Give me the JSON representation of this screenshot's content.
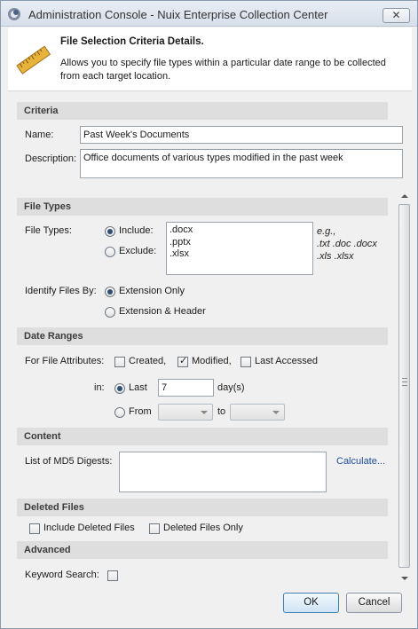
{
  "window": {
    "title": "Administration Console - Nuix Enterprise Collection Center",
    "close_label": "✕"
  },
  "header": {
    "title": "File Selection Criteria Details.",
    "description": "Allows you to specify file types within a particular date range to be collected from each target location."
  },
  "criteria": {
    "section_label": "Criteria",
    "name_label": "Name:",
    "name_value": "Past Week's Documents",
    "description_label": "Description:",
    "description_value": "Office documents of various types modified in the past week"
  },
  "file_types": {
    "section_label": "File Types",
    "label": "File Types:",
    "include_label": "Include:",
    "exclude_label": "Exclude:",
    "mode_selected": "include",
    "values": [
      ".docx",
      ".pptx",
      ".xlsx"
    ],
    "hint_prefix": "e.g.,",
    "hint_line1": ".txt .doc .docx",
    "hint_line2": ".xls .xlsx",
    "identify_label": "Identify Files By:",
    "extension_only_label": "Extension Only",
    "extension_header_label": "Extension & Header",
    "identify_selected": "extension_only"
  },
  "date_ranges": {
    "section_label": "Date Ranges",
    "attributes_label": "For File Attributes:",
    "created_label": "Created,",
    "created_checked": false,
    "modified_label": "Modified,",
    "modified_checked": true,
    "last_accessed_label": "Last Accessed",
    "last_accessed_checked": false,
    "in_label": "in:",
    "last_label": "Last",
    "last_value": "7",
    "days_label": "day(s)",
    "from_label": "From",
    "to_label": "to",
    "range_selected": "last"
  },
  "content": {
    "section_label": "Content",
    "md5_label": "List of MD5 Digests:",
    "md5_value": "",
    "calculate_label": "Calculate..."
  },
  "deleted_files": {
    "section_label": "Deleted Files",
    "include_deleted_label": "Include Deleted Files",
    "include_deleted_checked": false,
    "deleted_only_label": "Deleted Files Only",
    "deleted_only_checked": false
  },
  "advanced": {
    "section_label": "Advanced",
    "keyword_label": "Keyword Search:",
    "keyword_checked": false
  },
  "buttons": {
    "ok_label": "OK",
    "cancel_label": "Cancel"
  },
  "icons": {
    "app": "app-icon",
    "header": "ruler-icon"
  }
}
